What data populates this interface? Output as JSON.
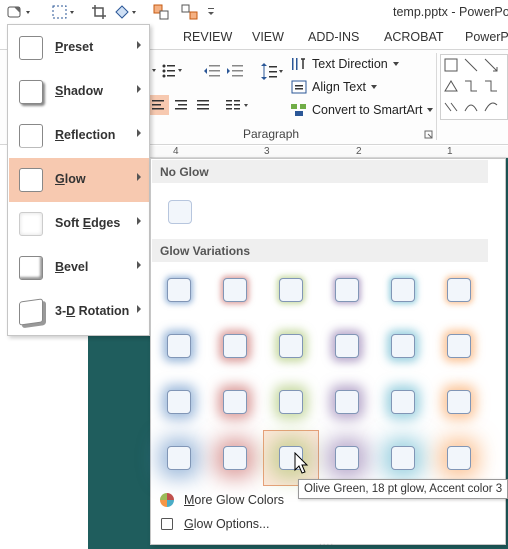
{
  "window": {
    "title": "temp.pptx - PowerPoi"
  },
  "ribbon_tabs": [
    "REVIEW",
    "VIEW",
    "ADD-INS",
    "ACROBAT",
    "PowerPo"
  ],
  "paragraph_group": {
    "text_direction": "Text Direction",
    "align_text": "Align Text",
    "convert_smartart": "Convert to SmartArt",
    "label": "Paragraph"
  },
  "ruler": {
    "ticks": [
      "4",
      "3",
      "2",
      "1"
    ]
  },
  "effects_menu": {
    "items": [
      {
        "label": "Preset",
        "ul": "P",
        "rest": "reset"
      },
      {
        "label": "Shadow",
        "ul": "S",
        "rest": "hadow"
      },
      {
        "label": "Reflection",
        "ul": "R",
        "rest": "eflection"
      },
      {
        "label": "Glow",
        "ul": "G",
        "rest": "low",
        "active": true
      },
      {
        "label": "Soft Edges",
        "pre": "Soft ",
        "ul": "E",
        "rest": "dges"
      },
      {
        "label": "Bevel",
        "ul": "B",
        "rest": "evel"
      },
      {
        "label": "3-D Rotation",
        "pre": "3-",
        "ul": "D",
        "rest": " Rotation"
      }
    ]
  },
  "glow_gallery": {
    "no_glow_header": "No Glow",
    "variations_header": "Glow Variations",
    "accent_colors": [
      "#4f81bd",
      "#c0504d",
      "#9bbb59",
      "#8064a2",
      "#4bacc6",
      "#f79646"
    ],
    "glow_sizes_pt": [
      5,
      8,
      11,
      18
    ],
    "hovered": {
      "row": 3,
      "col": 2
    },
    "more_colors": {
      "label": "More Glow Colors",
      "ul": "M",
      "rest": "ore Glow Colors"
    },
    "options": {
      "label": "Glow Options...",
      "ul": "G",
      "rest": "low Options..."
    }
  },
  "tooltip": "Olive Green, 18 pt glow, Accent color 3"
}
